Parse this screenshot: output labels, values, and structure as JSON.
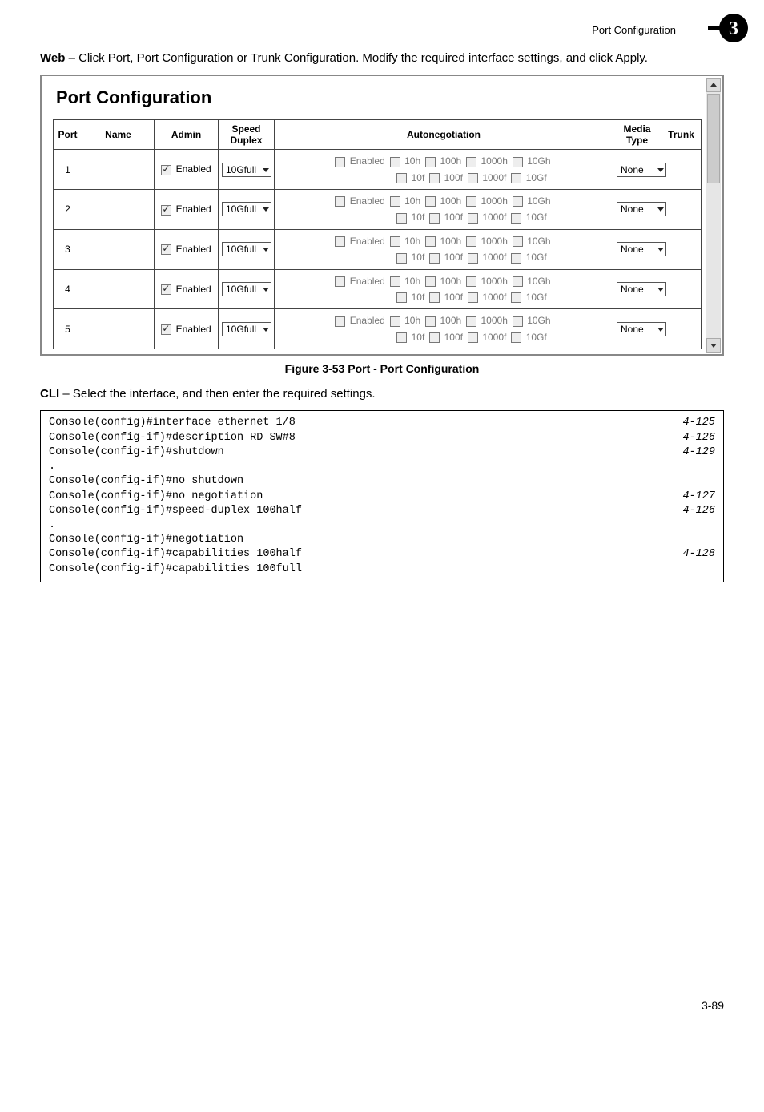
{
  "running_head": "Port Configuration",
  "chapter_badge": "3",
  "intro_para_prefix": "Web",
  "intro_para_rest": " – Click Port, Port Configuration or Trunk Configuration. Modify the required interface settings, and click Apply.",
  "panel_title": "Port Configuration",
  "headers": {
    "port": "Port",
    "name": "Name",
    "admin": "Admin",
    "speed_duplex": "Speed Duplex",
    "autoneg": "Autonegotiation",
    "media": "Media Type",
    "trunk": "Trunk"
  },
  "row_common": {
    "admin_label": "Enabled",
    "admin_checked": true,
    "speed_select": "10Gfull",
    "media_select": "None",
    "auto_row1": [
      {
        "label": "Enabled"
      },
      {
        "label": "10h"
      },
      {
        "label": "100h"
      },
      {
        "label": "1000h"
      },
      {
        "label": "10Gh"
      }
    ],
    "auto_row2": [
      {
        "label": "10f"
      },
      {
        "label": "100f"
      },
      {
        "label": "1000f"
      },
      {
        "label": "10Gf"
      }
    ]
  },
  "rows": [
    {
      "port": "1"
    },
    {
      "port": "2"
    },
    {
      "port": "3"
    },
    {
      "port": "4"
    },
    {
      "port": "5"
    }
  ],
  "figure_caption": "Figure 3-53   Port - Port Configuration",
  "cli_intro_prefix": "CLI",
  "cli_intro_rest": " – Select the interface, and then enter the required settings.",
  "cli_lines": [
    {
      "cmd": "Console(config)#interface ethernet 1/8",
      "ref": "4-125"
    },
    {
      "cmd": "Console(config-if)#description RD SW#8",
      "ref": "4-126"
    },
    {
      "cmd": "Console(config-if)#shutdown",
      "ref": "4-129"
    },
    {
      "cmd": ".",
      "ref": ""
    },
    {
      "cmd": "Console(config-if)#no shutdown",
      "ref": ""
    },
    {
      "cmd": "Console(config-if)#no negotiation",
      "ref": "4-127"
    },
    {
      "cmd": "Console(config-if)#speed-duplex 100half",
      "ref": "4-126"
    },
    {
      "cmd": ".",
      "ref": ""
    },
    {
      "cmd": "Console(config-if)#negotiation",
      "ref": ""
    },
    {
      "cmd": "Console(config-if)#capabilities 100half",
      "ref": "4-128"
    },
    {
      "cmd": "Console(config-if)#capabilities 100full",
      "ref": ""
    }
  ],
  "page_number": "3-89"
}
